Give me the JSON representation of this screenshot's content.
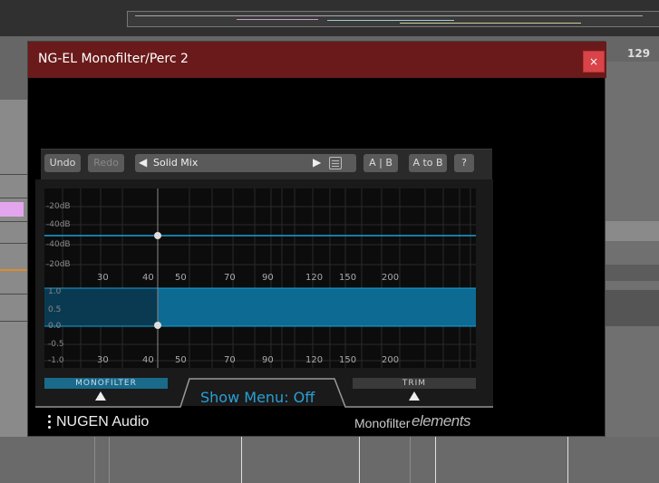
{
  "daw": {
    "tempo": "129"
  },
  "window": {
    "title": "NG-EL Monofilter/Perc 2",
    "close_label": "×"
  },
  "toolbar": {
    "undo": "Undo",
    "redo": "Redo",
    "preset_prev": "◀",
    "preset_name": "Solid Mix",
    "preset_next": "▶",
    "ab": "A | B",
    "a_to_b": "A to B",
    "help": "?"
  },
  "graph": {
    "top_db_labels": [
      "-20dB",
      "-40dB",
      "-40dB",
      "-20dB"
    ],
    "freq_labels_top": [
      "30",
      "40",
      "50",
      "70",
      "90",
      "120",
      "150",
      "200"
    ],
    "lower_labels": [
      "1.0",
      "0.5",
      "0.0",
      "-0.5",
      "-1.0"
    ],
    "freq_labels_bottom": [
      "30",
      "40",
      "50",
      "70",
      "90",
      "120",
      "150",
      "200"
    ],
    "colors": {
      "accent": "#1aa0d8",
      "fill": "#0d6a93",
      "fill_dark": "#0a3a52"
    }
  },
  "controls": {
    "monofilter_label": "MONOFILTER",
    "trim_label": "TRIM",
    "show_menu": "Show Menu: Off"
  },
  "footer": {
    "brand": "NUGEN Audio",
    "product_name": "Monofilter",
    "product_suffix": "elements"
  }
}
